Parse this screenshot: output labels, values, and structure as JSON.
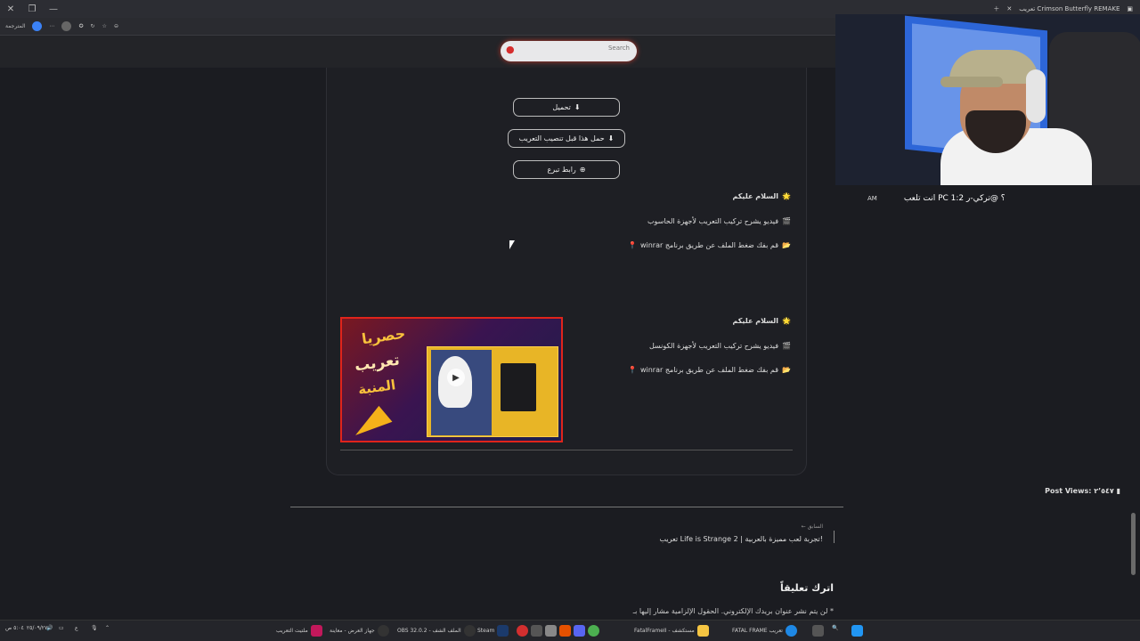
{
  "browser": {
    "tab_title": "تعريب Crimson Butterfly REMAKE",
    "toolbar_label": "المترجمة"
  },
  "search": {
    "placeholder": "Search"
  },
  "download_buttons": [
    {
      "label": "تحميل"
    },
    {
      "label": "حمل هذا قبل تنصيب التعريب"
    },
    {
      "label": "رابط تبرع"
    }
  ],
  "pc_section": {
    "greeting": "السلام عليكم",
    "video_line": "فيديو يشرح تركيب التعريب لأجهزة الحاسوب",
    "winrar_line": "قم بفك ضغط الملف عن طريق برنامج winrar"
  },
  "console_section": {
    "greeting": "السلام عليكم",
    "video_line": "فيديو يشرح تركيب التعريب لأجهزة الكونسل",
    "winrar_line": "قم بفك ضغط الملف عن طريق برنامج winrar"
  },
  "promo": {
    "line1": "حصريا",
    "line2": "تعريب",
    "line3": "المنبة"
  },
  "post_views": "Post Views: ٢٬٥٤٧",
  "prev_post": {
    "label": "← السابق",
    "title": "تعريب Life is Strange 2 | تجربة لعب مميزة بالعربية!"
  },
  "comments": {
    "heading": "اترك تعليقاً",
    "notice": "لن يتم نشر عنوان بريدك الإلكتروني. الحقول الإلزامية مشار إليها بـ *"
  },
  "stream": {
    "chat_message": "انت تلعب PC ؟ @تركي-ر 1:2",
    "time": "AM"
  },
  "taskbar": {
    "items": [
      {
        "label": "ملتيت التعريب"
      },
      {
        "label": "جهاز العرض - معاينة"
      },
      {
        "label": "OBS 32.0.2 - الملف الشف"
      },
      {
        "label": "Steam"
      },
      {
        "label": "FatalFrameII - مستكشف"
      },
      {
        "label": "FATAL FRAME تعريب"
      }
    ],
    "date": "٢٥/٠٩/٢٧",
    "time": "٥:٠٤ ص",
    "lang": "ع"
  }
}
